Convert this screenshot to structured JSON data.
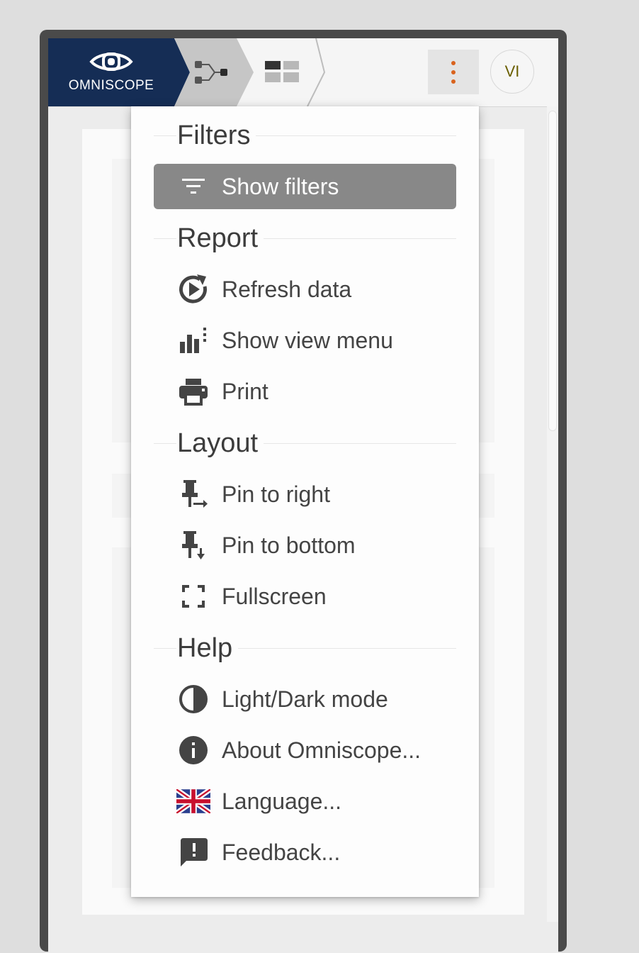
{
  "logo": {
    "text": "OMNISCOPE"
  },
  "header": {
    "avatar_initials": "VI"
  },
  "colors": {
    "brand_navy": "#152d55",
    "kebab_accent": "#d9631e",
    "active_item_bg": "#888888",
    "avatar_text": "#6a5f00"
  },
  "menu": {
    "sections": [
      {
        "title": "Filters",
        "items": [
          {
            "label": "Show filters",
            "icon": "filter-icon",
            "active": true
          }
        ]
      },
      {
        "title": "Report",
        "items": [
          {
            "label": "Refresh data",
            "icon": "refresh-play-icon"
          },
          {
            "label": "Show view menu",
            "icon": "bar-chart-menu-icon"
          },
          {
            "label": "Print",
            "icon": "printer-icon"
          }
        ]
      },
      {
        "title": "Layout",
        "items": [
          {
            "label": "Pin to right",
            "icon": "pin-right-icon"
          },
          {
            "label": "Pin to bottom",
            "icon": "pin-bottom-icon"
          },
          {
            "label": "Fullscreen",
            "icon": "fullscreen-icon"
          }
        ]
      },
      {
        "title": "Help",
        "items": [
          {
            "label": "Light/Dark mode",
            "icon": "contrast-icon"
          },
          {
            "label": "About Omniscope...",
            "icon": "info-icon"
          },
          {
            "label": "Language...",
            "icon": "uk-flag-icon"
          },
          {
            "label": "Feedback...",
            "icon": "feedback-icon"
          }
        ]
      }
    ]
  }
}
